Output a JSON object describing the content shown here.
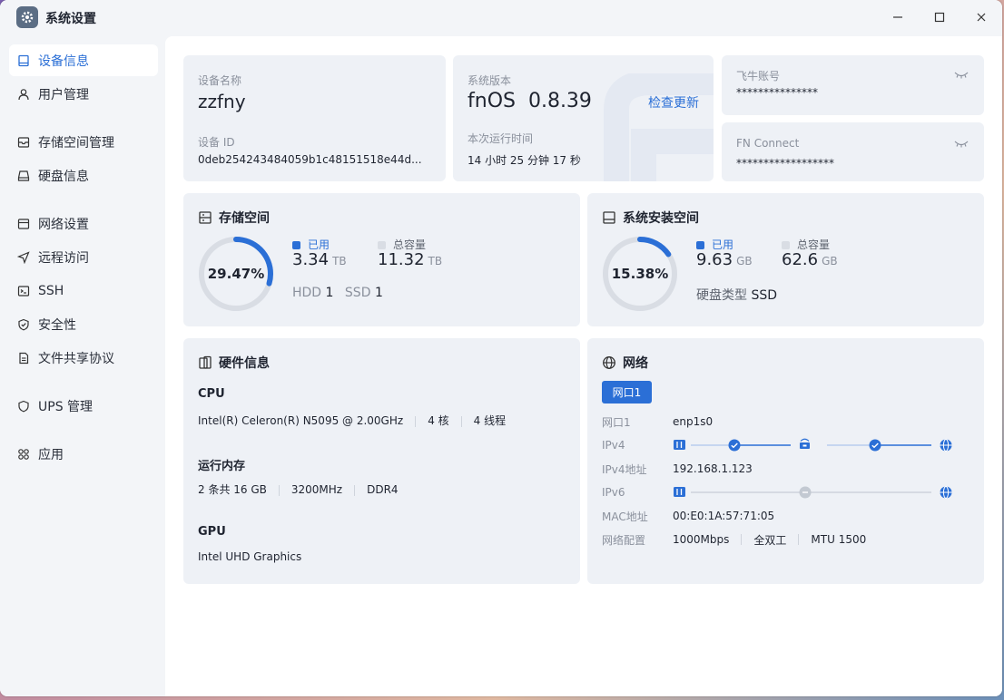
{
  "window": {
    "title": "系统设置",
    "minimize": "–",
    "maximize": "☐",
    "close": "✕"
  },
  "sidebar": {
    "items": [
      {
        "label": "设备信息",
        "icon": "device-icon",
        "active": true
      },
      {
        "label": "用户管理",
        "icon": "user-icon"
      },
      {
        "label": "存储空间管理",
        "icon": "storage-icon"
      },
      {
        "label": "硬盘信息",
        "icon": "disk-icon"
      },
      {
        "label": "网络设置",
        "icon": "network-icon"
      },
      {
        "label": "远程访问",
        "icon": "remote-icon"
      },
      {
        "label": "SSH",
        "icon": "ssh-icon"
      },
      {
        "label": "安全性",
        "icon": "shield-icon"
      },
      {
        "label": "文件共享协议",
        "icon": "file-icon"
      },
      {
        "label": "UPS 管理",
        "icon": "ups-icon"
      },
      {
        "label": "应用",
        "icon": "apps-icon"
      }
    ]
  },
  "device": {
    "name_label": "设备名称",
    "name": "zzfny",
    "id_label": "设备 ID",
    "id": "0deb254243484059b1c48151518e44d..."
  },
  "system": {
    "version_label": "系统版本",
    "version": "fnOS  0.8.39",
    "check_update": "检查更新",
    "uptime_label": "本次运行时间",
    "uptime": "14 小时 25 分钟 17 秒"
  },
  "accounts": {
    "feiniu_label": "飞牛账号",
    "feiniu_value": "***************",
    "fnconnect_label": "FN Connect",
    "fnconnect_value": "******************"
  },
  "storage": {
    "title": "存储空间",
    "percent": "29.47%",
    "used_fraction": 0.2947,
    "used_label": "已用",
    "used_value": "3.34",
    "used_unit": "TB",
    "total_label": "总容量",
    "total_value": "11.32",
    "total_unit": "TB",
    "hdd_label": "HDD",
    "hdd_count": "1",
    "ssd_label": "SSD",
    "ssd_count": "1"
  },
  "system_space": {
    "title": "系统安装空间",
    "percent": "15.38%",
    "used_fraction": 0.1538,
    "used_label": "已用",
    "used_value": "9.63",
    "used_unit": "GB",
    "total_label": "总容量",
    "total_value": "62.6",
    "total_unit": "GB",
    "disk_type_label": "硬盘类型",
    "disk_type": "SSD"
  },
  "hardware": {
    "title": "硬件信息",
    "cpu_label": "CPU",
    "cpu_model": "Intel(R) Celeron(R) N5095 @ 2.00GHz",
    "cpu_cores": "4 核",
    "cpu_threads": "4 线程",
    "mem_label": "运行内存",
    "mem_size": "2 条共 16 GB",
    "mem_speed": "3200MHz",
    "mem_type": "DDR4",
    "gpu_label": "GPU",
    "gpu_model": "Intel UHD Graphics"
  },
  "network": {
    "title": "网络",
    "tab": "网口1",
    "rows": {
      "port_label": "网口1",
      "port_value": "enp1s0",
      "ipv4_label": "IPv4",
      "ipv4addr_label": "IPv4地址",
      "ipv4addr_value": "192.168.1.123",
      "ipv6_label": "IPv6",
      "mac_label": "MAC地址",
      "mac_value": "00:E0:1A:57:71:05",
      "config_label": "网络配置",
      "speed": "1000Mbps",
      "duplex": "全双工",
      "mtu": "MTU 1500"
    }
  },
  "colors": {
    "accent": "#2b6fd6",
    "track": "#d9dde4",
    "card": "#eef1f6"
  }
}
